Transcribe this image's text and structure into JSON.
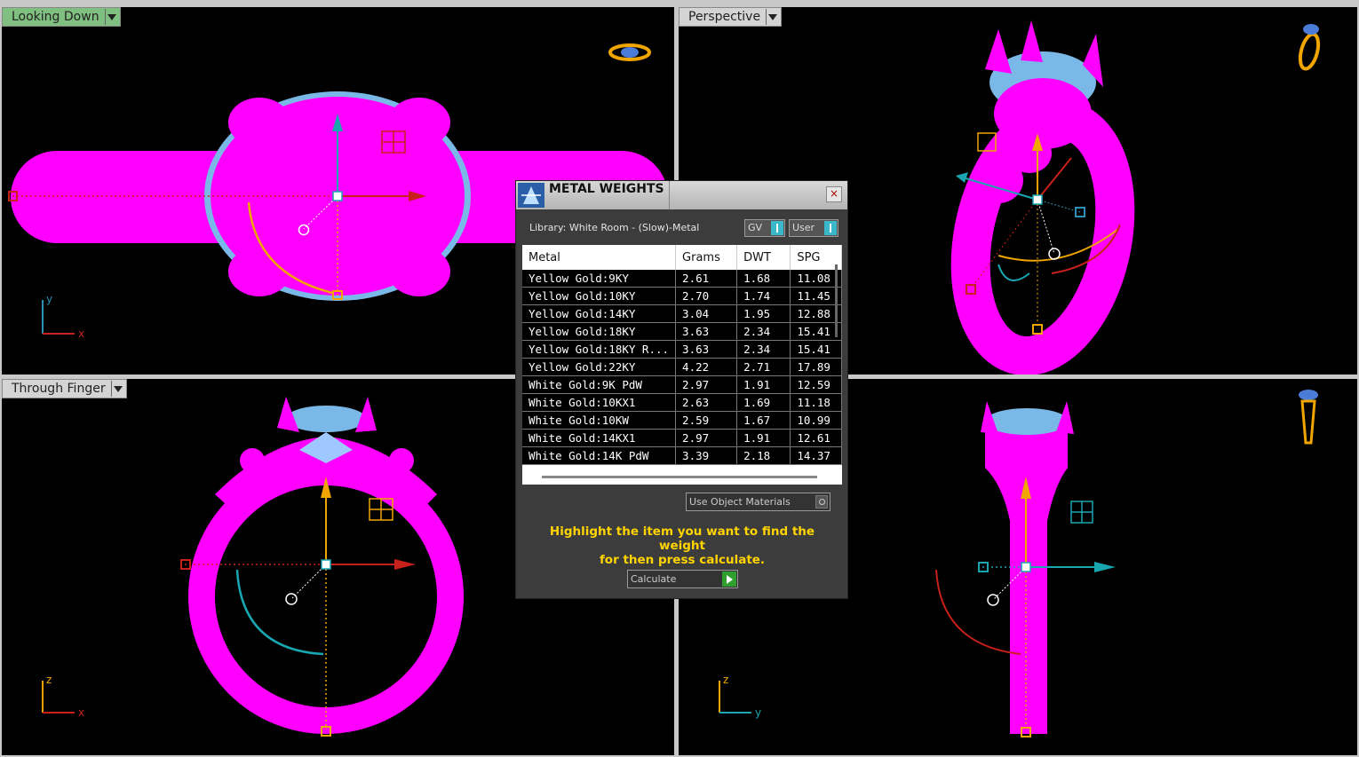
{
  "viewports": {
    "top_left": {
      "label": "Looking Down",
      "active": true
    },
    "top_right": {
      "label": "Perspective"
    },
    "bottom_left": {
      "label": "Through Finger"
    },
    "bottom_right": {
      "label": ""
    }
  },
  "axes": {
    "top_left": {
      "v": "y",
      "h": "x"
    },
    "bottom_left": {
      "v": "z",
      "h": "x"
    },
    "bottom_right": {
      "v": "z",
      "h": "y"
    }
  },
  "dialog": {
    "title": "METAL WEIGHTS",
    "close": "×",
    "library_label": "Library: White Room - (Slow)-Metal",
    "gv_label": "GV",
    "user_label": "User",
    "columns": [
      "Metal",
      "Grams",
      "DWT",
      "SPG"
    ],
    "rows": [
      [
        "Yellow Gold:9KY",
        "2.61",
        "1.68",
        "11.08"
      ],
      [
        "Yellow Gold:10KY",
        "2.70",
        "1.74",
        "11.45"
      ],
      [
        "Yellow Gold:14KY",
        "3.04",
        "1.95",
        "12.88"
      ],
      [
        "Yellow Gold:18KY",
        "3.63",
        "2.34",
        "15.41"
      ],
      [
        "Yellow Gold:18KY R...",
        "3.63",
        "2.34",
        "15.41"
      ],
      [
        "Yellow Gold:22KY",
        "4.22",
        "2.71",
        "17.89"
      ],
      [
        "White Gold:9K PdW",
        "2.97",
        "1.91",
        "12.59"
      ],
      [
        "White Gold:10KX1",
        "2.63",
        "1.69",
        "11.18"
      ],
      [
        "White Gold:10KW",
        "2.59",
        "1.67",
        "10.99"
      ],
      [
        "White Gold:14KX1",
        "2.97",
        "1.91",
        "12.61"
      ],
      [
        "White Gold:14K PdW",
        "3.39",
        "2.18",
        "14.37"
      ]
    ],
    "use_object_materials": "Use Object Materials",
    "hint_line1": "Highlight the item you want to find the weight",
    "hint_line2": "for then press calculate.",
    "calculate_label": "Calculate"
  },
  "colors": {
    "ring": "#ff00ff",
    "gem": "#9ec8ff",
    "gizmo_red": "#c8201a",
    "gizmo_yellow": "#f0a500",
    "gizmo_teal": "#1aa6b0",
    "hint": "#ffd400"
  }
}
